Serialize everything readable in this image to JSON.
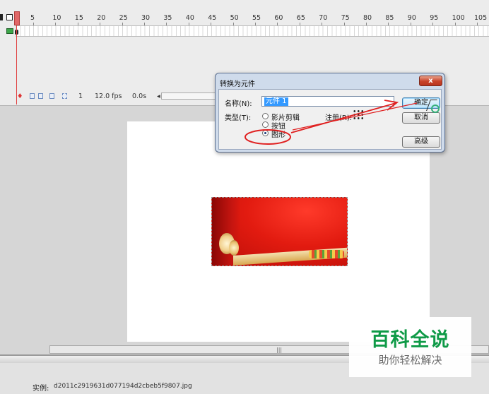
{
  "timeline": {
    "frame_numbers": [
      "5",
      "10",
      "15",
      "20",
      "25",
      "30",
      "35",
      "40",
      "45",
      "50",
      "55",
      "60",
      "65",
      "70",
      "75",
      "80",
      "85",
      "90",
      "95",
      "100",
      "105"
    ],
    "current_frame": "1",
    "frame_rate": "12.0 fps",
    "elapsed_time": "0.0s"
  },
  "dialog": {
    "title": "转换为元件",
    "close_label": "x",
    "name_label": "名称(N):",
    "name_value": "元件 1",
    "type_label": "类型(T):",
    "type_options": [
      "影片剪辑",
      "按钮",
      "图形"
    ],
    "selected_type": "图形",
    "registration_label": "注册(R):",
    "ok_label": "确定",
    "cancel_label": "取消",
    "advanced_label": "高级"
  },
  "properties": {
    "instance_label": "实例:",
    "instance_value": "d2011c2919631d077194d2cbeb5f9807.jpg"
  },
  "annotation": {
    "color": "#e02020"
  },
  "watermark": {
    "title": "百科全说",
    "subtitle": "助你轻松解决"
  }
}
